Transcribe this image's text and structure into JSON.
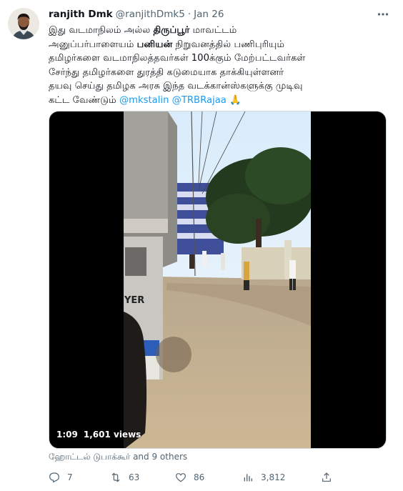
{
  "tweet": {
    "author_name": "ranjith Dmk",
    "author_handle": "@ranjithDmk5",
    "separator": "·",
    "date": "Jan 26",
    "text": {
      "line1_a": "இது வடமாநிலம் அல்ல ",
      "line1_bold": "திருப்பூர்",
      "line1_b": " மாவட்டம்",
      "line2_a": "அனுப்பர்பாளையம் ",
      "line2_bold": "பனியன்",
      "line2_b": " நிறுவனத்தில் பணிபுரியும்",
      "line3": "தமிழர்களை வடமாநிலத்தவர்கள் 100க்கும் மேற்பட்டவர்கள்",
      "line4": "சேர்ந்து தமிழர்களை துரத்தி கடுமையாக தாக்கியுள்ளனர்",
      "line5": "தயவு செய்து தமிழக அரசு இந்த வடக்கான்ஸ்களுக்கு முடிவு",
      "line6_a": "கட்ட வேண்டும் ",
      "mention1": "@mkstalin",
      "mention2": "@TRBRajaa",
      "emoji": "🙏"
    },
    "video": {
      "duration": "1:09",
      "views": "1,601 views",
      "sign_text": "YER"
    },
    "social_context": "ஹோட்டல் டுபாக்கூர் and 9 others",
    "actions": {
      "replies": "7",
      "retweets": "63",
      "likes": "86",
      "views": "3,812"
    },
    "icons": [
      "more-icon",
      "reply-icon",
      "retweet-icon",
      "like-icon",
      "views-icon",
      "share-icon"
    ],
    "colors": {
      "accent": "#1d9bf0",
      "muted": "#536471",
      "text": "#0f1419"
    }
  }
}
